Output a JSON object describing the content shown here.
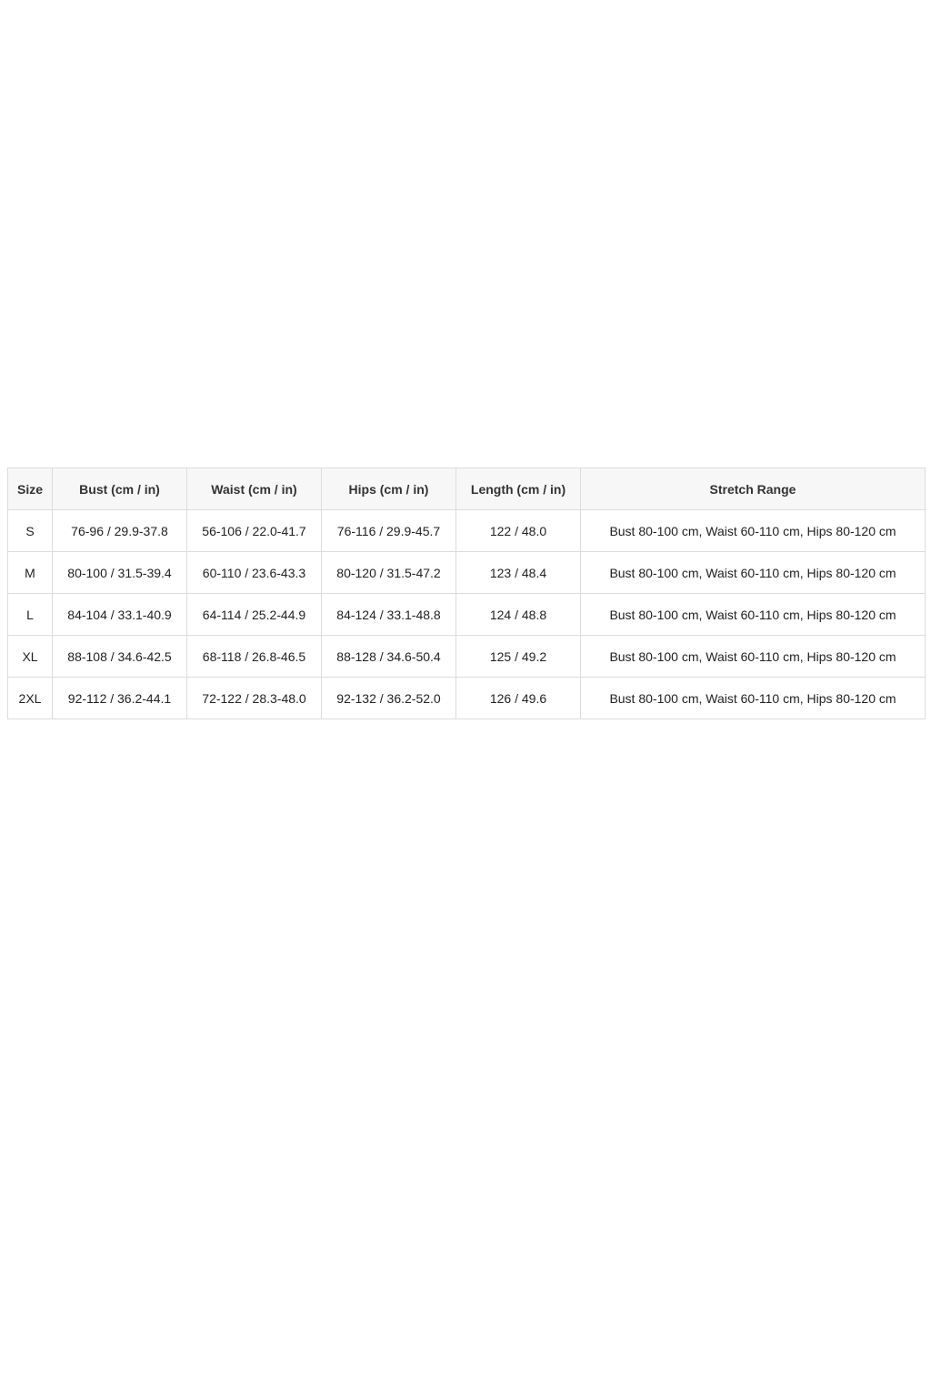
{
  "size_chart": {
    "headers": [
      "Size",
      "Bust (cm / in)",
      "Waist (cm / in)",
      "Hips (cm / in)",
      "Length (cm / in)",
      "Stretch Range"
    ],
    "rows": [
      [
        "S",
        "76-96 / 29.9-37.8",
        "56-106 / 22.0-41.7",
        "76-116 / 29.9-45.7",
        "122 / 48.0",
        "Bust 80-100 cm, Waist 60-110 cm, Hips 80-120 cm"
      ],
      [
        "M",
        "80-100 / 31.5-39.4",
        "60-110 / 23.6-43.3",
        "80-120 / 31.5-47.2",
        "123 / 48.4",
        "Bust 80-100 cm, Waist 60-110 cm, Hips 80-120 cm"
      ],
      [
        "L",
        "84-104 / 33.1-40.9",
        "64-114 / 25.2-44.9",
        "84-124 / 33.1-48.8",
        "124 / 48.8",
        "Bust 80-100 cm, Waist 60-110 cm, Hips 80-120 cm"
      ],
      [
        "XL",
        "88-108 / 34.6-42.5",
        "68-118 / 26.8-46.5",
        "88-128 / 34.6-50.4",
        "125 / 49.2",
        "Bust 80-100 cm, Waist 60-110 cm, Hips 80-120 cm"
      ],
      [
        "2XL",
        "92-112 / 36.2-44.1",
        "72-122 / 28.3-48.0",
        "92-132 / 36.2-52.0",
        "126 / 49.6",
        "Bust 80-100 cm, Waist 60-110 cm, Hips 80-120 cm"
      ]
    ]
  },
  "colors": {
    "border": "#dcdcdc",
    "header_background": "#f7f7f7",
    "text": "#222222",
    "page_background": "#ffffff"
  }
}
